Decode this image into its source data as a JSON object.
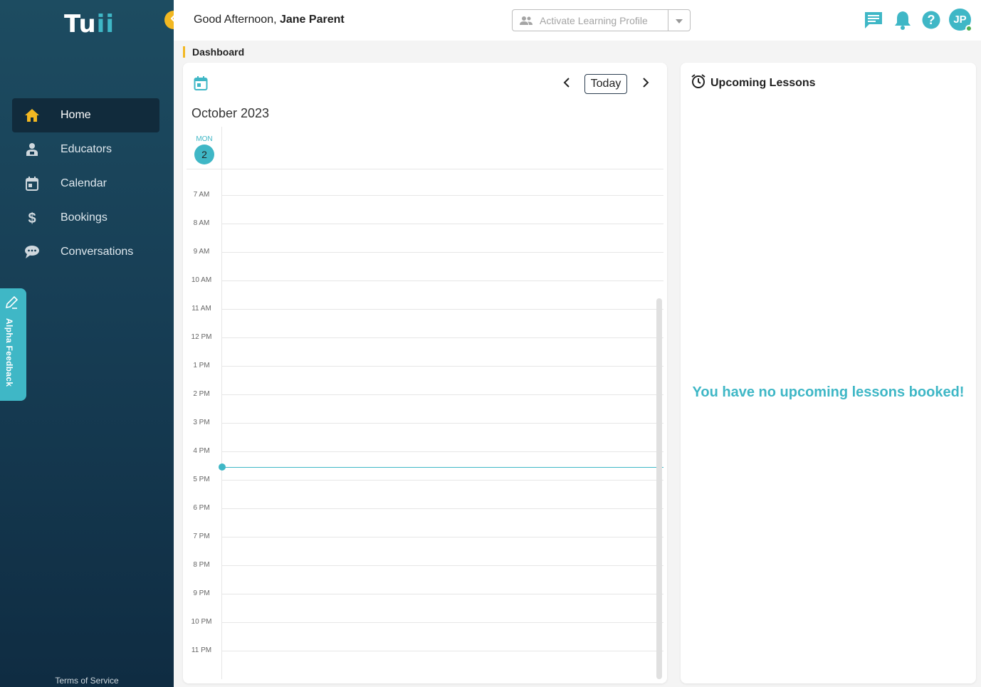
{
  "app": {
    "logo_main": "Tu",
    "logo_accent": "ii",
    "terms_label": "Terms of Service",
    "feedback_label": "Alpha Feedback"
  },
  "sidebar": {
    "items": [
      {
        "label": "Home",
        "icon": "home-icon",
        "active": true
      },
      {
        "label": "Educators",
        "icon": "educators-icon",
        "active": false
      },
      {
        "label": "Calendar",
        "icon": "calendar-icon",
        "active": false
      },
      {
        "label": "Bookings",
        "icon": "dollar-icon",
        "active": false
      },
      {
        "label": "Conversations",
        "icon": "chat-bubble-icon",
        "active": false
      }
    ]
  },
  "header": {
    "greeting_prefix": "Good Afternoon,",
    "user_name": "Jane Parent",
    "profile_select_placeholder": "Activate Learning Profile",
    "avatar_initials": "JP"
  },
  "breadcrumb": "Dashboard",
  "calendar": {
    "month_title": "October 2023",
    "today_label": "Today",
    "day_name": "MON",
    "day_number": "2",
    "hours": [
      "7 AM",
      "8 AM",
      "9 AM",
      "10 AM",
      "11 AM",
      "12 PM",
      "1 PM",
      "2 PM",
      "3 PM",
      "4 PM",
      "5 PM",
      "6 PM",
      "7 PM",
      "8 PM",
      "9 PM",
      "10 PM",
      "11 PM"
    ]
  },
  "lessons": {
    "title": "Upcoming Lessons",
    "empty_message": "You have no upcoming lessons booked!"
  },
  "colors": {
    "accent_teal": "#3fb7c6",
    "accent_yellow": "#f2b822",
    "sidebar_dark": "#173e55"
  }
}
